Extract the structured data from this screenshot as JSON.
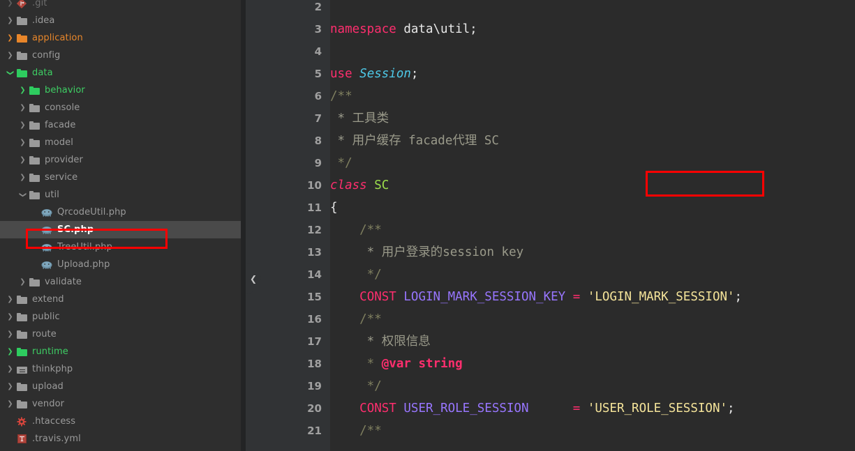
{
  "app": {
    "theme_background": "#2b2b2b",
    "sidebar_background": "#2e2e2e",
    "gutter_background": "#313335",
    "selection_background": "#4a4a4a",
    "annotation_color": "#ff0000"
  },
  "sidebar": {
    "name": "project-tree",
    "collapse_handle_icon": "chevron-left-icon",
    "items": [
      {
        "label": ".git",
        "indent": 0,
        "icon": "git-icon",
        "arrow": "chevron-right",
        "arrow_style": "dim",
        "label_style": "dim",
        "selected": false
      },
      {
        "label": ".idea",
        "indent": 0,
        "icon": "folder-gray",
        "arrow": "chevron-right",
        "arrow_style": "normal",
        "label_style": "gray",
        "selected": false
      },
      {
        "label": "application",
        "indent": 0,
        "icon": "folder-orange",
        "arrow": "chevron-right",
        "arrow_style": "orange",
        "label_style": "orange",
        "selected": false
      },
      {
        "label": "config",
        "indent": 0,
        "icon": "folder-gray",
        "arrow": "chevron-right",
        "arrow_style": "normal",
        "label_style": "gray",
        "selected": false
      },
      {
        "label": "data",
        "indent": 0,
        "icon": "folder-green",
        "arrow": "chevron-down",
        "arrow_style": "green",
        "label_style": "green",
        "selected": false
      },
      {
        "label": "behavior",
        "indent": 1,
        "icon": "folder-green",
        "arrow": "chevron-right",
        "arrow_style": "green",
        "label_style": "green",
        "selected": false
      },
      {
        "label": "console",
        "indent": 1,
        "icon": "folder-gray",
        "arrow": "chevron-right",
        "arrow_style": "normal",
        "label_style": "gray",
        "selected": false
      },
      {
        "label": "facade",
        "indent": 1,
        "icon": "folder-gray",
        "arrow": "chevron-right",
        "arrow_style": "normal",
        "label_style": "gray",
        "selected": false
      },
      {
        "label": "model",
        "indent": 1,
        "icon": "folder-gray",
        "arrow": "chevron-right",
        "arrow_style": "normal",
        "label_style": "gray",
        "selected": false
      },
      {
        "label": "provider",
        "indent": 1,
        "icon": "folder-gray",
        "arrow": "chevron-right",
        "arrow_style": "normal",
        "label_style": "gray",
        "selected": false
      },
      {
        "label": "service",
        "indent": 1,
        "icon": "folder-gray",
        "arrow": "chevron-right",
        "arrow_style": "normal",
        "label_style": "gray",
        "selected": false
      },
      {
        "label": "util",
        "indent": 1,
        "icon": "folder-gray",
        "arrow": "chevron-down",
        "arrow_style": "normal",
        "label_style": "gray",
        "selected": false
      },
      {
        "label": "QrcodeUtil.php",
        "indent": 2,
        "icon": "php-icon",
        "arrow": "none",
        "arrow_style": "none",
        "label_style": "gray",
        "selected": false
      },
      {
        "label": "SC.php",
        "indent": 2,
        "icon": "php-icon",
        "arrow": "none",
        "arrow_style": "none",
        "label_style": "white",
        "selected": true
      },
      {
        "label": "TreeUtil.php",
        "indent": 2,
        "icon": "php-icon",
        "arrow": "none",
        "arrow_style": "none",
        "label_style": "gray",
        "selected": false
      },
      {
        "label": "Upload.php",
        "indent": 2,
        "icon": "php-icon",
        "arrow": "none",
        "arrow_style": "none",
        "label_style": "gray",
        "selected": false
      },
      {
        "label": "validate",
        "indent": 1,
        "icon": "folder-gray",
        "arrow": "chevron-right",
        "arrow_style": "normal",
        "label_style": "gray",
        "selected": false
      },
      {
        "label": "extend",
        "indent": 0,
        "icon": "folder-gray",
        "arrow": "chevron-right",
        "arrow_style": "normal",
        "label_style": "gray",
        "selected": false
      },
      {
        "label": "public",
        "indent": 0,
        "icon": "folder-gray",
        "arrow": "chevron-right",
        "arrow_style": "normal",
        "label_style": "gray",
        "selected": false
      },
      {
        "label": "route",
        "indent": 0,
        "icon": "folder-gray",
        "arrow": "chevron-right",
        "arrow_style": "normal",
        "label_style": "gray",
        "selected": false
      },
      {
        "label": "runtime",
        "indent": 0,
        "icon": "folder-green",
        "arrow": "chevron-right",
        "arrow_style": "green",
        "label_style": "green",
        "selected": false
      },
      {
        "label": "thinkphp",
        "indent": 0,
        "icon": "folder-module",
        "arrow": "chevron-right",
        "arrow_style": "normal",
        "label_style": "gray",
        "selected": false
      },
      {
        "label": "upload",
        "indent": 0,
        "icon": "folder-gray",
        "arrow": "chevron-right",
        "arrow_style": "normal",
        "label_style": "gray",
        "selected": false
      },
      {
        "label": "vendor",
        "indent": 0,
        "icon": "folder-gray",
        "arrow": "chevron-right",
        "arrow_style": "normal",
        "label_style": "gray",
        "selected": false
      },
      {
        "label": ".htaccess",
        "indent": 0,
        "icon": "gear-red-icon",
        "arrow": "none",
        "arrow_style": "none",
        "label_style": "gray",
        "selected": false
      },
      {
        "label": ".travis.yml",
        "indent": 0,
        "icon": "yaml-icon",
        "arrow": "none",
        "arrow_style": "none",
        "label_style": "gray",
        "selected": false
      }
    ]
  },
  "editor": {
    "first_visible_line": 2,
    "last_visible_line": 21,
    "line_numbers": [
      "2",
      "3",
      "4",
      "5",
      "6",
      "7",
      "8",
      "9",
      "10",
      "11",
      "12",
      "13",
      "14",
      "15",
      "16",
      "17",
      "18",
      "19",
      "20",
      "21"
    ],
    "lines": [
      {
        "n": "2",
        "text": ""
      },
      {
        "n": "3",
        "text": "namespace data\\util;"
      },
      {
        "n": "4",
        "text": ""
      },
      {
        "n": "5",
        "text": "use Session;"
      },
      {
        "n": "6",
        "text": "/**"
      },
      {
        "n": "7",
        "text": " * 工具类"
      },
      {
        "n": "8",
        "text": " * 用户缓存 facade代理 SC"
      },
      {
        "n": "9",
        "text": " */"
      },
      {
        "n": "10",
        "text": "class SC"
      },
      {
        "n": "11",
        "text": "{"
      },
      {
        "n": "12",
        "text": "    /**"
      },
      {
        "n": "13",
        "text": "     * 用户登录的session key"
      },
      {
        "n": "14",
        "text": "     */"
      },
      {
        "n": "15",
        "text": "    CONST LOGIN_MARK_SESSION_KEY = 'LOGIN_MARK_SESSION';"
      },
      {
        "n": "16",
        "text": "    /**"
      },
      {
        "n": "17",
        "text": "     * 权限信息"
      },
      {
        "n": "18",
        "text": "     * @var string"
      },
      {
        "n": "19",
        "text": "     */"
      },
      {
        "n": "20",
        "text": "    CONST USER_ROLE_SESSION      = 'USER_ROLE_SESSION';"
      },
      {
        "n": "21",
        "text": "    /**"
      }
    ],
    "tokens": {
      "l3_kw": "namespace",
      "l3_rest": " data\\util;",
      "l5_kw": "use",
      "l5_type": "Session",
      "l5_semi": ";",
      "l6": "/**",
      "l7": " * 工具类",
      "l8": " * 用户缓存 facade代理 SC",
      "l9": " */",
      "l10_kw": "class",
      "l10_name": "SC",
      "l11": "{",
      "l12": "    /**",
      "l13": "     * 用户登录的session key",
      "l14": "     */",
      "l15_kw": "CONST",
      "l15_const": "LOGIN_MARK_SESSION_KEY",
      "l15_eq": "=",
      "l15_str": "'LOGIN_MARK_SESSION'",
      "l15_semi": ";",
      "l16": "    /**",
      "l17": "     * 权限信息",
      "l18_star": "     * ",
      "l18_tag": "@var",
      "l18_type": " string",
      "l19": "     */",
      "l20_kw": "CONST",
      "l20_const": "USER_ROLE_SESSION",
      "l20_eq": "=",
      "l20_str": "'USER_ROLE_SESSION'",
      "l20_semi": ";",
      "l21": "    /**"
    }
  },
  "annotations": [
    {
      "name": "sidebar-file-highlight",
      "target": "SC.php",
      "color": "#ff0000"
    },
    {
      "name": "class-declaration-highlight",
      "target": "class SC",
      "color": "#ff0000"
    }
  ]
}
